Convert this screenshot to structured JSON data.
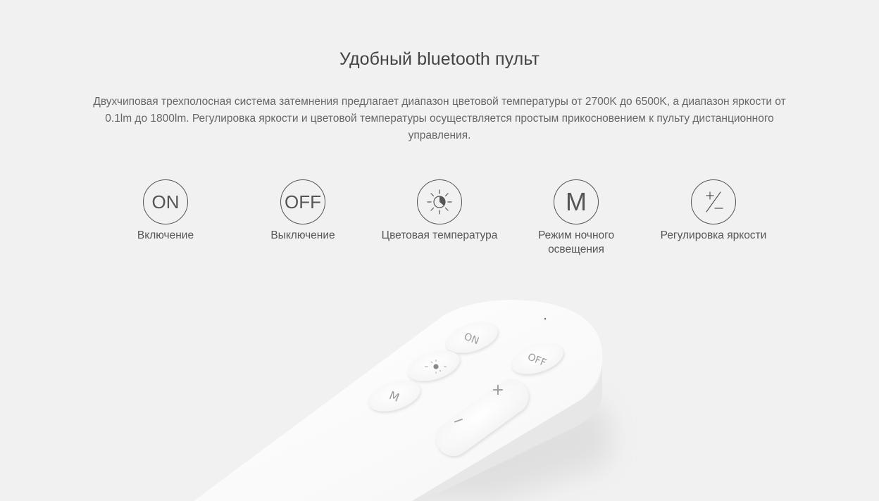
{
  "section": {
    "title": "Удобный bluetooth пульт",
    "description": "Двухчиповая трехполосная система затемнения предлагает диапазон цветовой температуры от 2700K до 6500K, а диапазон яркости от 0.1lm до 1800lm. Регулировка яркости и цветовой температуры осуществляется простым прикосновением к пульту дистанционного управления."
  },
  "features": [
    {
      "icon_text": "ON",
      "icon": "on-icon",
      "label": "Включение"
    },
    {
      "icon_text": "OFF",
      "icon": "off-icon",
      "label": "Выключение"
    },
    {
      "icon_text": "",
      "icon": "color-temperature-icon",
      "label": "Цветовая температура"
    },
    {
      "icon_text": "M",
      "icon": "night-mode-icon",
      "label": "Режим ночного освещения"
    },
    {
      "icon_text": "",
      "icon": "brightness-plus-minus-icon",
      "label": "Регулировка яркости"
    }
  ],
  "remote": {
    "buttons": {
      "on": "ON",
      "off": "OFF",
      "mode": "M",
      "plus": "+",
      "minus": "−"
    }
  }
}
